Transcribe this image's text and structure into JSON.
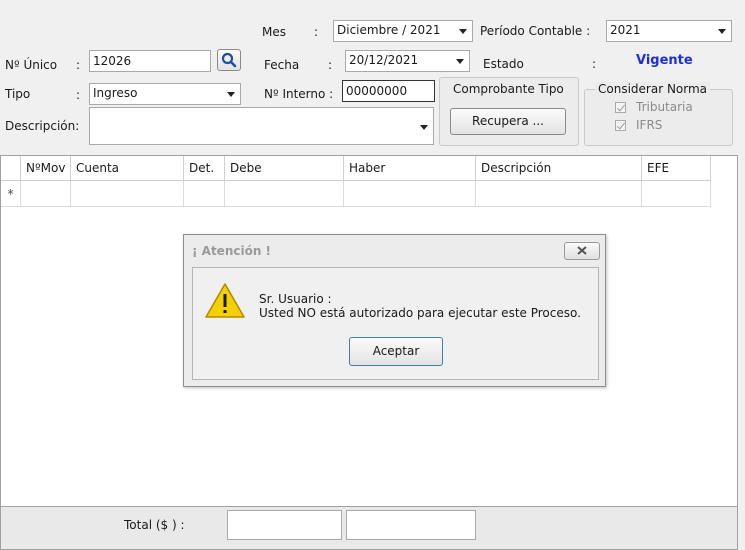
{
  "header": {
    "mes_label": "Mes",
    "colon": ":",
    "mes_value": "Diciembre / 2021",
    "periodo_label": "Período Contable :",
    "periodo_value": "2021",
    "nro_unico_label": "Nº Único",
    "nro_unico_value": "12026",
    "fecha_label": "Fecha",
    "fecha_value": "20/12/2021",
    "estado_label": "Estado",
    "estado_value": "Vigente",
    "tipo_label": "Tipo",
    "tipo_value": "Ingreso",
    "nro_interno_label": "Nº Interno :",
    "nro_interno_value": "00000000",
    "descripcion_label": "Descripción:",
    "descripcion_value": ""
  },
  "comprobante": {
    "title": "Comprobante Tipo",
    "recupera_label": "Recupera ..."
  },
  "norma": {
    "title": "Considerar Norma",
    "tributaria": "Tributaria",
    "ifrs": "IFRS"
  },
  "grid": {
    "columns": [
      "NºMov",
      "Cuenta",
      "Det.",
      "Debe",
      "Haber",
      "Descripción",
      "EFE"
    ],
    "new_row_marker": "*"
  },
  "footer": {
    "total_label": "Total ($  ) :",
    "total_debe": "",
    "total_haber": ""
  },
  "dialog": {
    "title": "¡ Atención !",
    "line1": "Sr. Usuario :",
    "line2": "Usted NO está autorizado para ejecutar este Proceso.",
    "accept_label": "Aceptar"
  },
  "colors": {
    "estado": "#1f2fd6",
    "warning_fill": "#f5d000"
  }
}
